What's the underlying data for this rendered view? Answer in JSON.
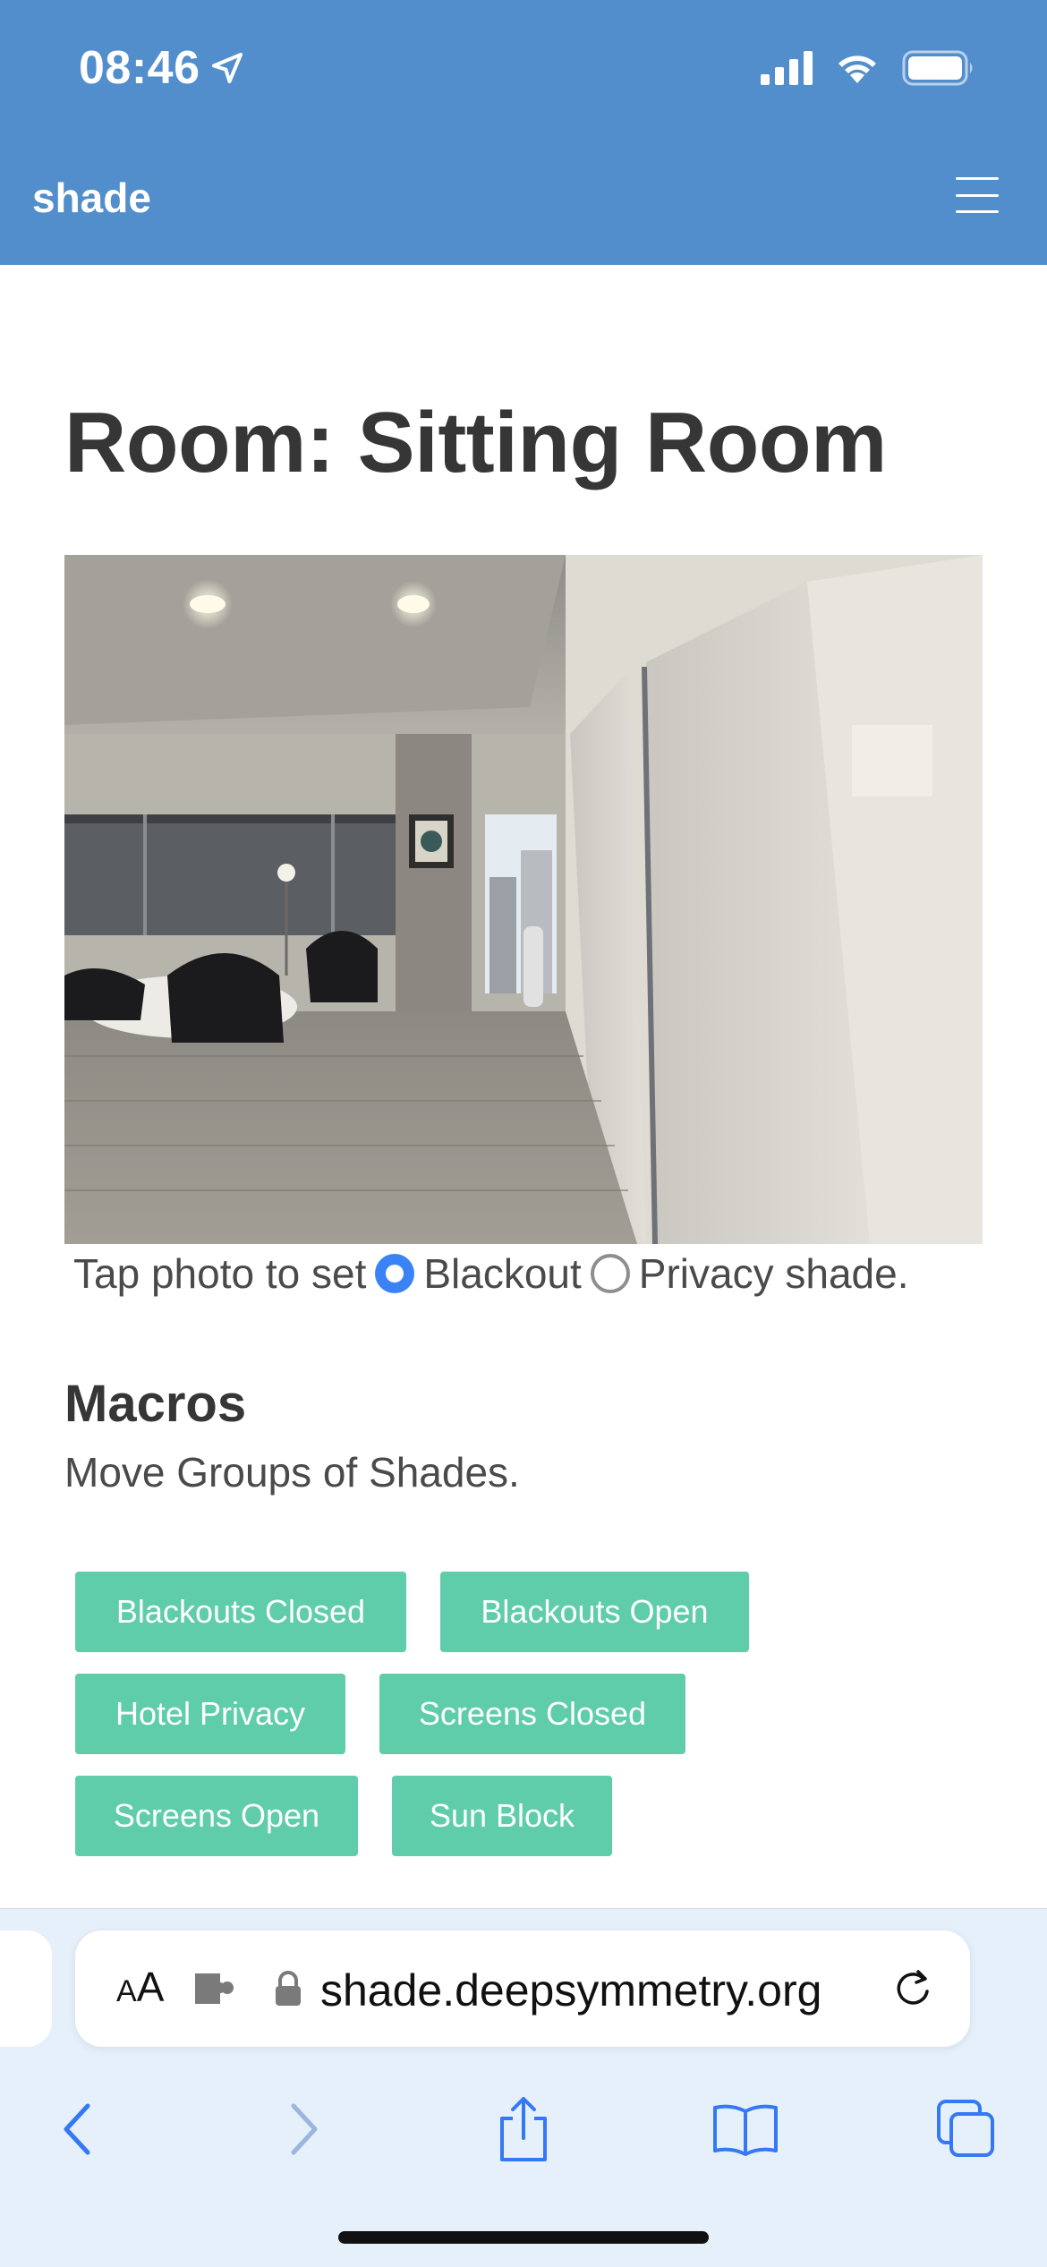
{
  "status_bar": {
    "time": "08:46",
    "icons": [
      "location-arrow-icon",
      "cellular-signal-icon",
      "wifi-icon",
      "battery-icon"
    ]
  },
  "navbar": {
    "brand": "shade",
    "menu_icon": "hamburger-menu-icon",
    "color": "#528dcc"
  },
  "main": {
    "title": "Room: Sitting Room",
    "photo_description_icon": "room-photo",
    "caption": {
      "prefix": "Tap photo to set",
      "options": [
        {
          "label": "Blackout",
          "checked": true
        },
        {
          "label": "Privacy shade.",
          "checked": false
        }
      ]
    },
    "macros": {
      "title": "Macros",
      "subtitle": "Move Groups of Shades.",
      "buttons": [
        "Blackouts Closed",
        "Blackouts Open",
        "Hotel Privacy",
        "Screens Closed",
        "Screens Open",
        "Sun Block"
      ],
      "button_color": "#5fcda9"
    }
  },
  "browser": {
    "text_size_label": "AA",
    "url": "shade.deepsymmetry.org",
    "icons": [
      "extension-icon",
      "lock-icon",
      "reload-icon",
      "back-icon",
      "forward-icon",
      "share-icon",
      "bookmarks-icon",
      "tabs-icon"
    ]
  }
}
